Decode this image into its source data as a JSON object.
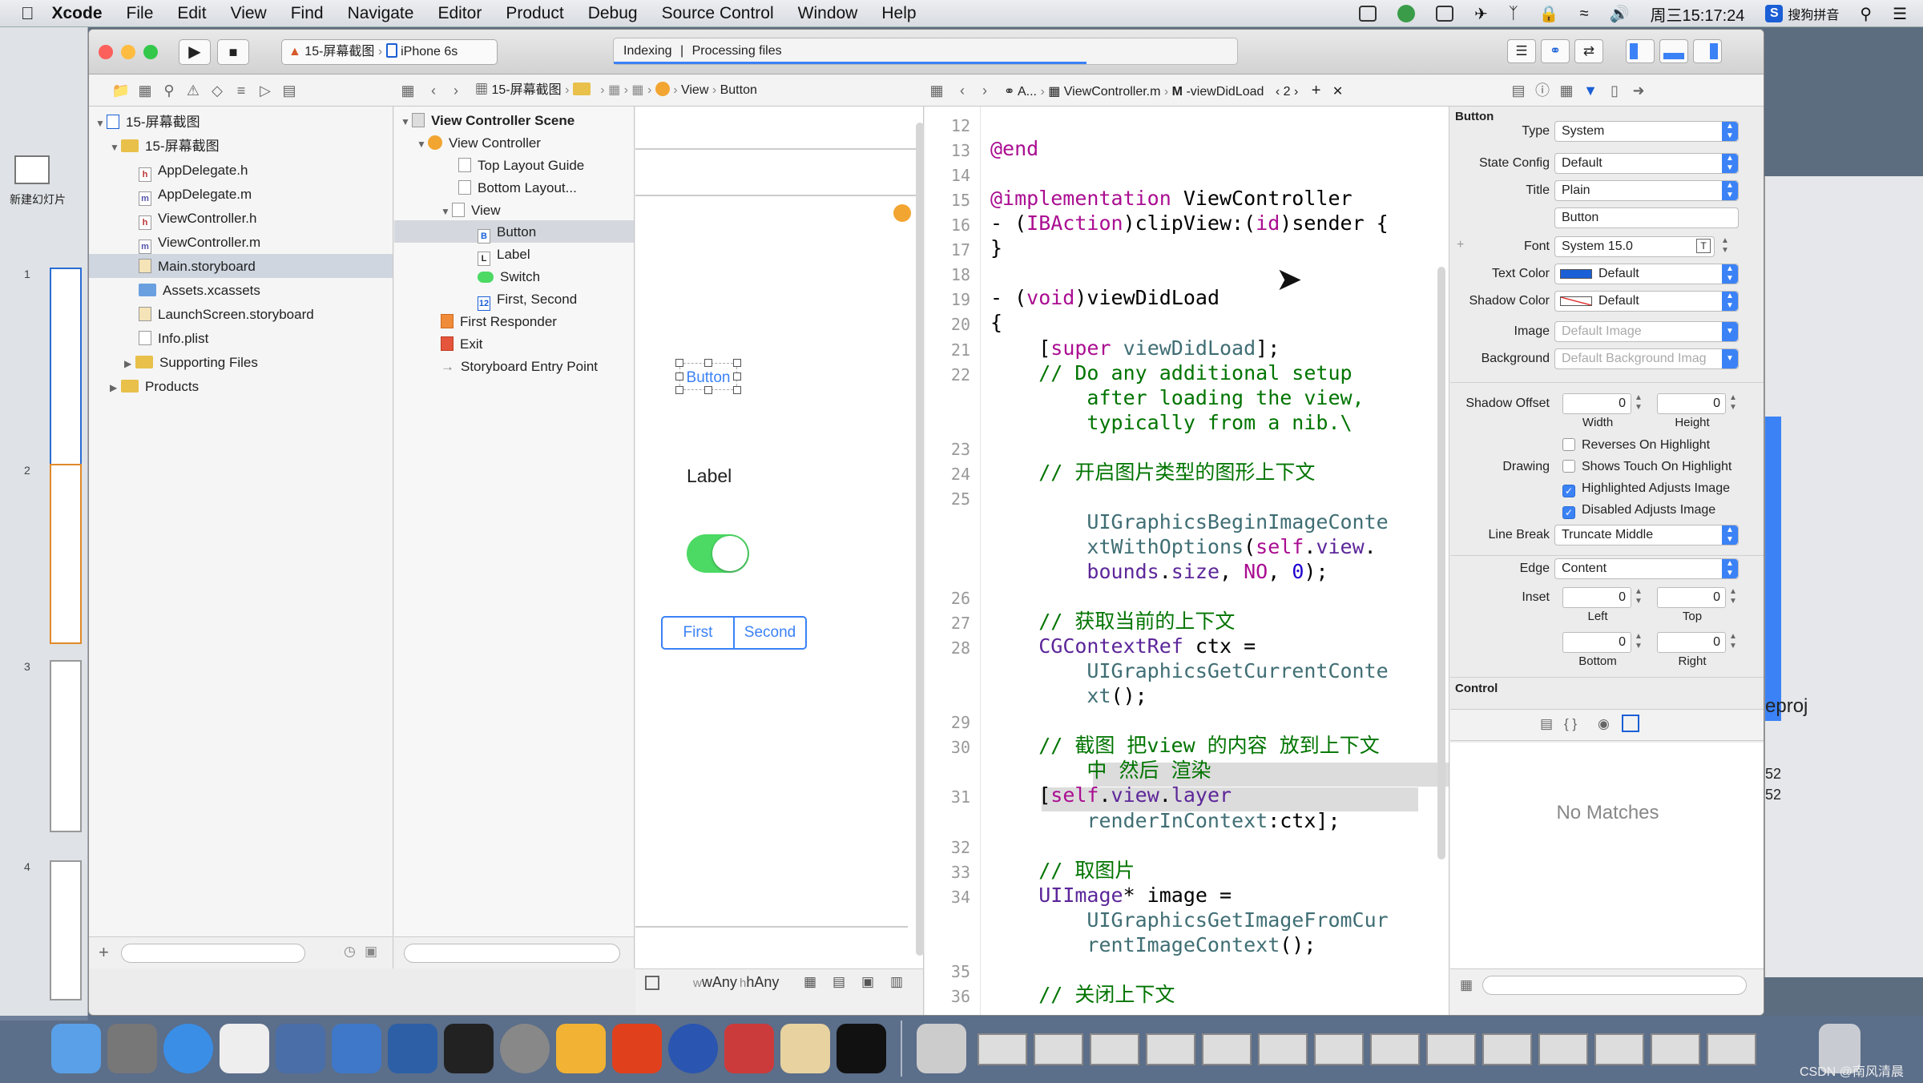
{
  "menubar": {
    "apple": "",
    "app": "Xcode",
    "items": [
      "File",
      "Edit",
      "View",
      "Find",
      "Navigate",
      "Editor",
      "Product",
      "Debug",
      "Source Control",
      "Window",
      "Help"
    ],
    "clock": "周三15:17:24",
    "ime": "搜狗拼音"
  },
  "keynote": {
    "new_slide": "新建幻灯片",
    "slide_numbers": [
      "1",
      "2",
      "3",
      "4"
    ]
  },
  "toolbar": {
    "scheme": "15-屏幕截图",
    "device": "iPhone 6s",
    "status_left": "Indexing",
    "status_sep": "|",
    "status_right": "Processing files"
  },
  "jumpbar_left": {
    "crumbs": [
      "15-屏幕截图",
      "View",
      "Button"
    ]
  },
  "jumpbar_right": {
    "crumbs": [
      "A...",
      "ViewController.m",
      "-viewDidLoad"
    ],
    "count": "2"
  },
  "navigator": {
    "project": "15-屏幕截图",
    "group": "15-屏幕截图",
    "files": [
      {
        "name": "AppDelegate.h",
        "kind": "h"
      },
      {
        "name": "AppDelegate.m",
        "kind": "m"
      },
      {
        "name": "ViewController.h",
        "kind": "h"
      },
      {
        "name": "ViewController.m",
        "kind": "m"
      },
      {
        "name": "Main.storyboard",
        "kind": "sb"
      },
      {
        "name": "Assets.xcassets",
        "kind": "folder"
      },
      {
        "name": "LaunchScreen.storyboard",
        "kind": "sb"
      },
      {
        "name": "Info.plist",
        "kind": "plist"
      }
    ],
    "supporting": "Supporting Files",
    "products": "Products"
  },
  "outline": {
    "scene": "View Controller Scene",
    "vc": "View Controller",
    "top_guide": "Top Layout Guide",
    "bottom_guide": "Bottom Layout...",
    "view": "View",
    "button": "Button",
    "label": "Label",
    "switch": "Switch",
    "segmented": "First, Second",
    "first_responder": "First Responder",
    "exit": "Exit",
    "entry": "Storyboard Entry Point"
  },
  "canvas": {
    "button": "Button",
    "label": "Label",
    "seg_first": "First",
    "seg_second": "Second",
    "size_w": "wAny",
    "size_h": "hAny"
  },
  "code": {
    "lines": [
      {
        "n": "12",
        "html": ""
      },
      {
        "n": "13",
        "html": "<span class='kw'>@end</span>"
      },
      {
        "n": "14",
        "html": ""
      },
      {
        "n": "15",
        "html": "<span class='kw'>@implementation</span> ViewController"
      },
      {
        "n": "16",
        "html": "- (<span class='kw'>IBAction</span>)clipView:(<span class='kw'>id</span>)sender {"
      },
      {
        "n": "17",
        "html": "}"
      },
      {
        "n": "18",
        "html": ""
      },
      {
        "n": "19",
        "html": "- (<span class='kw'>void</span>)viewDidLoad"
      },
      {
        "n": "20",
        "html": "{"
      },
      {
        "n": "21",
        "html": "    [<span class='kw'>super</span> <span class='fn'>viewDidLoad</span>];"
      },
      {
        "n": "22",
        "html": "    <span class='cm'>// Do any additional setup</span>"
      },
      {
        "n": "",
        "html": "        <span class='cm'>after loading the view,</span>"
      },
      {
        "n": "",
        "html": "        <span class='cm'>typically from a nib.\\</span>"
      },
      {
        "n": "23",
        "html": ""
      },
      {
        "n": "24",
        "html": "    <span class='cm'>// 开启图片类型的图形上下文</span>"
      },
      {
        "n": "25",
        "html": ""
      },
      {
        "n": "",
        "html": "        <span class='fn'>UIGraphicsBeginImageConte</span>"
      },
      {
        "n": "",
        "html": "        <span class='fn'>xtWithOptions</span>(<span class='kw'>self</span>.<span class='ty'>view</span>."
      },
      {
        "n": "",
        "html": "        <span class='ty'>bounds</span>.<span class='ty'>size</span>, <span class='kw'>NO</span>, <span class='nu'>0</span>);"
      },
      {
        "n": "26",
        "html": ""
      },
      {
        "n": "27",
        "html": "    <span class='cm'>// 获取当前的上下文</span>"
      },
      {
        "n": "28",
        "html": "    <span class='ty'>CGContextRef</span> ctx ="
      },
      {
        "n": "",
        "html": "        <span class='fn'>UIGraphicsGetCurrentConte</span>"
      },
      {
        "n": "",
        "html": "        <span class='fn'>xt</span>();"
      },
      {
        "n": "29",
        "html": ""
      },
      {
        "n": "30",
        "html": "    <span class='cm'>// 截图 把view 的内容 放到上下文</span>"
      },
      {
        "n": "",
        "html": "        <span class='cm'>中 然后 渲染</span>"
      },
      {
        "n": "31",
        "html": "    [<span class='kw'>self</span>.<span class='ty'>view</span>.<span class='ty'>layer</span>"
      },
      {
        "n": "",
        "html": "        <span class='fn'>renderInContext</span>:ctx];"
      },
      {
        "n": "32",
        "html": ""
      },
      {
        "n": "33",
        "html": "    <span class='cm'>// 取图片</span>"
      },
      {
        "n": "34",
        "html": "    <span class='ty'>UIImage</span>* image ="
      },
      {
        "n": "",
        "html": "        <span class='fn'>UIGraphicsGetImageFromCur</span>"
      },
      {
        "n": "",
        "html": "        <span class='fn'>rentImageContext</span>();"
      },
      {
        "n": "35",
        "html": ""
      },
      {
        "n": "36",
        "html": "    <span class='cm'>// 关闭上下文</span>"
      }
    ]
  },
  "inspector": {
    "section": "Button",
    "type_label": "Type",
    "type_value": "System",
    "state_label": "State Config",
    "state_value": "Default",
    "title_label": "Title",
    "title_value": "Plain",
    "title_text": "Button",
    "font_label": "Font",
    "font_value": "System 15.0",
    "textcolor_label": "Text Color",
    "textcolor_value": "Default",
    "textcolor_swatch": "#1a5fd6",
    "shadow_label": "Shadow Color",
    "shadow_value": "Default",
    "image_label": "Image",
    "image_value": "Default Image",
    "bg_label": "Background",
    "bg_value": "Default Background Imag",
    "shadow_offset_label": "Shadow Offset",
    "shadow_w": "0",
    "shadow_h": "0",
    "width_label": "Width",
    "height_label": "Height",
    "reverses": "Reverses On Highlight",
    "drawing_label": "Drawing",
    "shows_touch": "Shows Touch On Highlight",
    "highlighted": "Highlighted Adjusts Image",
    "disabled": "Disabled Adjusts Image",
    "linebreak_label": "Line Break",
    "linebreak_value": "Truncate Middle",
    "edge_label": "Edge",
    "edge_value": "Content",
    "inset_label": "Inset",
    "inset_left": "0",
    "inset_top": "0",
    "inset_bottom": "0",
    "inset_right": "0",
    "left_label": "Left",
    "top_label": "Top",
    "bottom_label": "Bottom",
    "right_label": "Right",
    "control_label": "Control",
    "no_matches": "No Matches"
  },
  "background_window": {
    "text1": "eproj",
    "text2": "52",
    "text3": "52"
  },
  "watermark": "CSDN @南风清晨"
}
